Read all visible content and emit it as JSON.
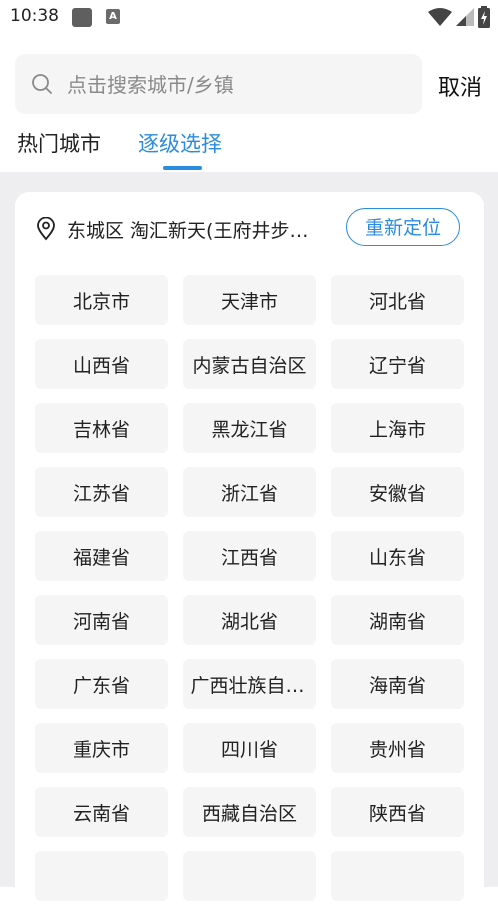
{
  "status_bar": {
    "time": "10:38",
    "icons": [
      "notification-square-icon",
      "app-a-icon",
      "wifi-icon",
      "signal-icon",
      "battery-icon"
    ],
    "app_icon_letter": "A"
  },
  "search": {
    "placeholder": "点击搜索城市/乡镇",
    "value": "",
    "cancel_label": "取消"
  },
  "tabs": [
    {
      "label": "热门城市",
      "active": false
    },
    {
      "label": "逐级选择",
      "active": true
    }
  ],
  "location": {
    "text": "东城区 淘汇新天(王府井步行街店)",
    "relocate_label": "重新定位"
  },
  "regions": [
    "北京市",
    "天津市",
    "河北省",
    "山西省",
    "内蒙古自治区",
    "辽宁省",
    "吉林省",
    "黑龙江省",
    "上海市",
    "江苏省",
    "浙江省",
    "安徽省",
    "福建省",
    "江西省",
    "山东省",
    "河南省",
    "湖北省",
    "湖南省",
    "广东省",
    "广西壮族自治区",
    "海南省",
    "重庆市",
    "四川省",
    "贵州省",
    "云南省",
    "西藏自治区",
    "陕西省",
    "",
    "",
    ""
  ],
  "colors": {
    "accent": "#2a8ce0",
    "background": "#eeeef0",
    "cell": "#f5f5f5"
  }
}
